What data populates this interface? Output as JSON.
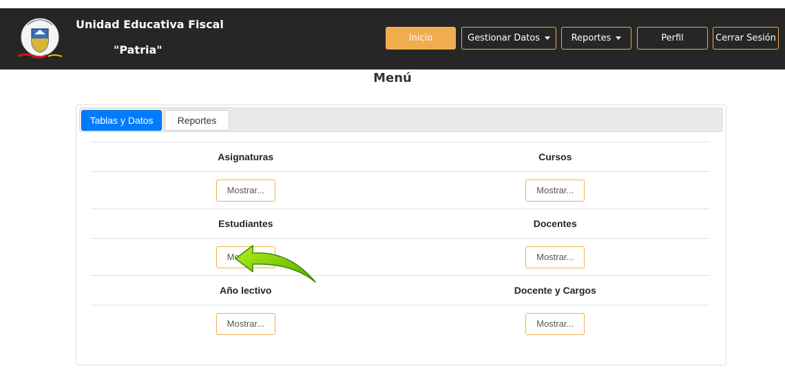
{
  "navbar": {
    "brand_line1": "Unidad Educativa Fiscal",
    "brand_line2": "\"Patria\"",
    "logo_icon": "school-crest-icon",
    "buttons": {
      "inicio": "Inicio",
      "gestionar": "Gestionar Datos",
      "reportes": "Reportes",
      "perfil": "Perfil",
      "cerrar": "Cerrar Sesión"
    }
  },
  "page": {
    "title": "Menú"
  },
  "tabs": {
    "tablas": "Tablas y Datos",
    "reportes": "Reportes"
  },
  "grid": {
    "items": [
      {
        "label": "Asignaturas",
        "button": "Mostrar..."
      },
      {
        "label": "Cursos",
        "button": "Mostrar..."
      },
      {
        "label": "Estudiantes",
        "button": "Mostrar..."
      },
      {
        "label": "Docentes",
        "button": "Mostrar..."
      },
      {
        "label": "Año lectivo",
        "button": "Mostrar..."
      },
      {
        "label": "Docente y Cargos",
        "button": "Mostrar..."
      }
    ]
  },
  "overlay": {
    "icon": "green-arrow-pointer-icon"
  },
  "colors": {
    "navbar_bg": "#262626",
    "accent_orange": "#f0ad4e",
    "tab_active_blue": "#007bff",
    "arrow_green": "#7ac70c"
  }
}
